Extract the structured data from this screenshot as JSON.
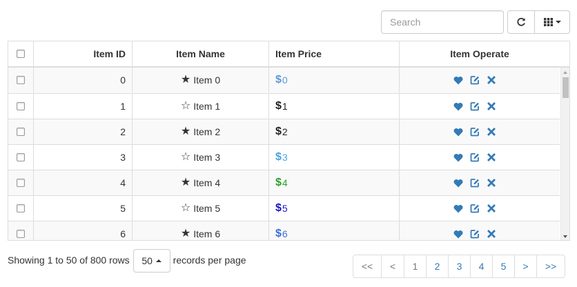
{
  "toolbar": {
    "search_placeholder": "Search",
    "refresh_icon": "refresh-icon",
    "columns_icon": "grid-icon"
  },
  "table": {
    "headers": {
      "id": "Item ID",
      "name": "Item Name",
      "price": "Item Price",
      "operate": "Item Operate"
    },
    "rows": [
      {
        "id": "0",
        "name": "Item 0",
        "star": "★",
        "price": "0",
        "dollar_color": "#5b9bd5",
        "price_color": "#5b9bd5"
      },
      {
        "id": "1",
        "name": "Item 1",
        "star": "☆",
        "price": "1",
        "dollar_color": "#222222",
        "price_color": "#222222"
      },
      {
        "id": "2",
        "name": "Item 2",
        "star": "★",
        "price": "2",
        "dollar_color": "#222222",
        "price_color": "#222222"
      },
      {
        "id": "3",
        "name": "Item 3",
        "star": "☆",
        "price": "3",
        "dollar_color": "#4aa3df",
        "price_color": "#4aa3df"
      },
      {
        "id": "4",
        "name": "Item 4",
        "star": "★",
        "price": "4",
        "dollar_color": "#2ca02c",
        "price_color": "#2ca02c"
      },
      {
        "id": "5",
        "name": "Item 5",
        "star": "☆",
        "price": "5",
        "dollar_color": "#1a13c7",
        "price_color": "#1a13c7"
      },
      {
        "id": "6",
        "name": "Item 6",
        "star": "★",
        "price": "6",
        "dollar_color": "#3b6fd6",
        "price_color": "#3b6fd6"
      }
    ],
    "operate_icons": [
      "heart-icon",
      "edit-icon",
      "remove-icon"
    ],
    "icon_color": "#337ab7"
  },
  "footer": {
    "showing_text": "Showing 1 to 50 of 800 rows",
    "page_size": "50",
    "records_text": "records per page",
    "pages": [
      "<<",
      "<",
      "1",
      "2",
      "3",
      "4",
      "5",
      ">",
      ">>"
    ]
  }
}
